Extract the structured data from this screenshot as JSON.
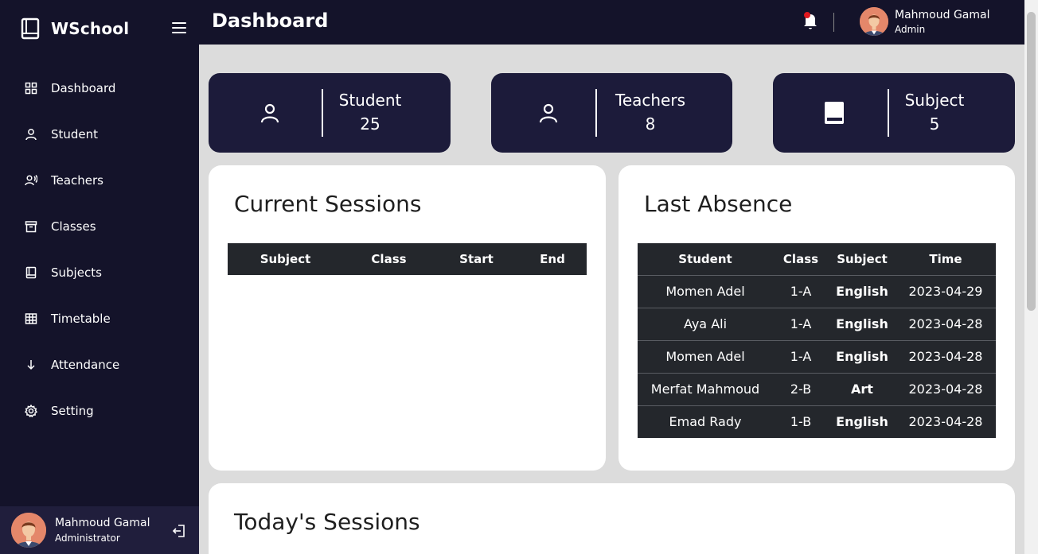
{
  "brand": {
    "name": "WSchool",
    "logo_icon": "book-icon"
  },
  "sidebar": {
    "items": [
      {
        "label": "Dashboard",
        "icon": "grid-icon"
      },
      {
        "label": "Student",
        "icon": "user-icon"
      },
      {
        "label": "Teachers",
        "icon": "teacher-icon"
      },
      {
        "label": "Classes",
        "icon": "archive-icon"
      },
      {
        "label": "Subjects",
        "icon": "book-icon"
      },
      {
        "label": "Timetable",
        "icon": "table-icon"
      },
      {
        "label": "Attendance",
        "icon": "arrow-down-icon"
      },
      {
        "label": "Setting",
        "icon": "gear-icon"
      }
    ],
    "user": {
      "name": "Mahmoud Gamal",
      "role": "Administrator"
    }
  },
  "header": {
    "title": "Dashboard",
    "user": {
      "name": "Mahmoud Gamal",
      "role": "Admin"
    },
    "notification_dot_color": "#e0181e"
  },
  "stats": [
    {
      "label": "Student",
      "value": "25",
      "icon": "user-icon"
    },
    {
      "label": "Teachers",
      "value": "8",
      "icon": "user-icon"
    },
    {
      "label": "Subject",
      "value": "5",
      "icon": "book-icon"
    }
  ],
  "current_sessions": {
    "title": "Current Sessions",
    "columns": [
      "Subject",
      "Class",
      "Start",
      "End"
    ]
  },
  "last_absence": {
    "title": "Last Absence",
    "columns": [
      "Student",
      "Class",
      "Subject",
      "Time"
    ],
    "rows": [
      [
        "Momen Adel",
        "1-A",
        "English",
        "2023-04-29"
      ],
      [
        "Aya Ali",
        "1-A",
        "English",
        "2023-04-28"
      ],
      [
        "Momen Adel",
        "1-A",
        "English",
        "2023-04-28"
      ],
      [
        "Merfat Mahmoud",
        "2-B",
        "Art",
        "2023-04-28"
      ],
      [
        "Emad Rady",
        "1-B",
        "English",
        "2023-04-28"
      ]
    ]
  },
  "todays_sessions": {
    "title": "Today's Sessions"
  },
  "colors": {
    "sidebar_bg": "#14132a",
    "card_bg": "#1c1b3a",
    "table_bg": "#24272c",
    "page_bg": "#dcdcdc"
  }
}
